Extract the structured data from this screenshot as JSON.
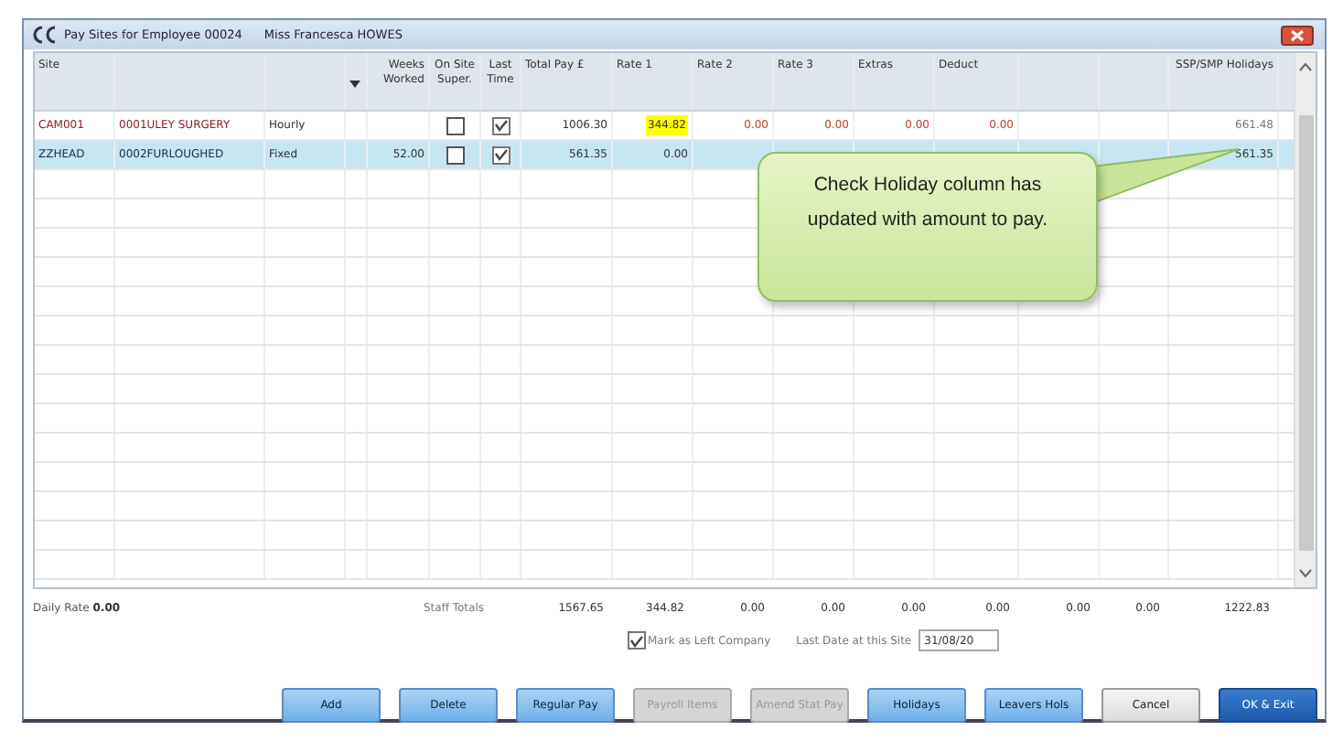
{
  "window": {
    "title": "Pay Sites for Employee 00024",
    "employee": "Miss Francesca HOWES"
  },
  "columns": [
    {
      "label": "Site"
    },
    {},
    {},
    {
      "sort": true
    },
    {
      "label": "Weeks Worked"
    },
    {
      "label": "On Site Super."
    },
    {
      "label": "Last Time"
    },
    {
      "label": "Total Pay £"
    },
    {
      "label": "Rate 1"
    },
    {
      "label": "Rate 2"
    },
    {
      "label": "Rate 3"
    },
    {
      "label": "Extras"
    },
    {
      "label": "Deduct"
    },
    {},
    {},
    {
      "label": "SSP/SMP Holidays"
    }
  ],
  "rows": [
    {
      "selected": false,
      "site": "CAM001",
      "name": "0001ULEY SURGERY",
      "type": "Hourly",
      "weeks_worked": "",
      "on_site_super": false,
      "last_time": true,
      "total_pay": "1006.30",
      "rate_1": "344.82",
      "rate_1_highlighted": true,
      "rate_2": "0.00",
      "rate_3": "0.00",
      "extras": "0.00",
      "deduct": "0.00",
      "ssp_smp_holidays": "661.48"
    },
    {
      "selected": true,
      "site": "ZZHEAD",
      "name": "0002FURLOUGHED",
      "type": "Fixed",
      "weeks_worked": "52.00",
      "on_site_super": false,
      "last_time": true,
      "total_pay": "561.35",
      "rate_1": "0.00",
      "rate_1_highlighted": false,
      "ssp_smp_holidays": "561.35"
    }
  ],
  "callout": "Check Holiday column has updated with amount to pay.",
  "totals": {
    "daily_rate_label": "Daily Rate",
    "daily_rate": "0.00",
    "label": "Staff Totals",
    "values": [
      "1567.65",
      "344.82",
      "0.00",
      "0.00",
      "0.00",
      "0.00",
      "0.00",
      "0.00",
      "1222.83"
    ]
  },
  "mark_as_left": {
    "label": "Mark as Left Company",
    "checked": true
  },
  "last_date": {
    "label": "Last Date at this Site",
    "value": "31/08/20"
  },
  "buttons": [
    {
      "label": "Add",
      "kind": "blue",
      "disabled": false
    },
    {
      "label": "Delete",
      "kind": "blue",
      "disabled": false
    },
    {
      "label": "Regular Pay",
      "kind": "blue",
      "disabled": false
    },
    {
      "label": "Payroll Items",
      "kind": "blue",
      "disabled": true
    },
    {
      "label": "Amend Stat Pay",
      "kind": "blue",
      "disabled": true
    },
    {
      "label": "Holidays",
      "kind": "blue",
      "disabled": false
    },
    {
      "label": "Leavers Hols",
      "kind": "blue",
      "disabled": false
    },
    {
      "label": "Cancel",
      "kind": "plain",
      "disabled": false
    },
    {
      "label": "OK & Exit",
      "kind": "primary",
      "disabled": false
    }
  ]
}
